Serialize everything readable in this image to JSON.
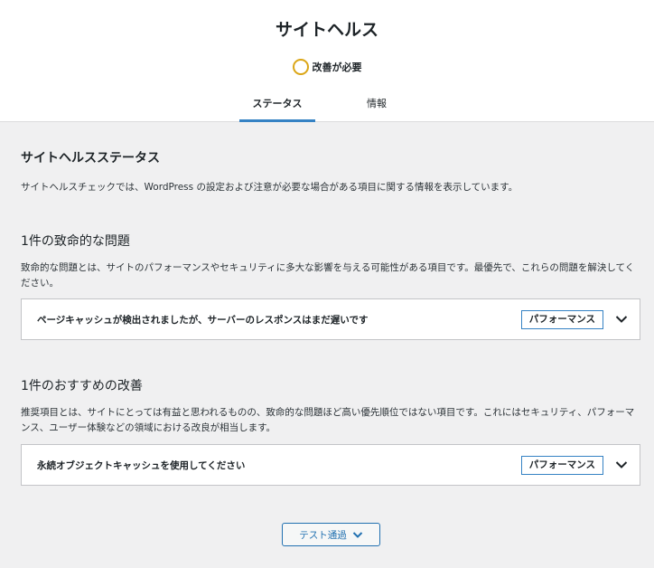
{
  "header": {
    "title": "サイトヘルス",
    "status_label": "改善が必要",
    "status_color": "#dba617",
    "tabs": [
      {
        "label": "ステータス",
        "active": true
      },
      {
        "label": "情報",
        "active": false
      }
    ]
  },
  "main": {
    "section_title": "サイトヘルスステータス",
    "section_desc": "サイトヘルスチェックでは、WordPress の設定および注意が必要な場合がある項目に関する情報を表示しています。",
    "critical": {
      "title": "1件の致命的な問題",
      "desc": "致命的な問題とは、サイトのパフォーマンスやセキュリティに多大な影響を与える可能性がある項目です。最優先で、これらの問題を解決してください。",
      "items": [
        {
          "label": "ページキャッシュが検出されましたが、サーバーのレスポンスはまだ遅いです",
          "badge": "パフォーマンス",
          "icon": "chevron-down-icon"
        }
      ]
    },
    "recommended": {
      "title": "1件のおすすめの改善",
      "desc": "推奨項目とは、サイトにとっては有益と思われるものの、致命的な問題ほど高い優先順位ではない項目です。これにはセキュリティ、パフォーマンス、ユーザー体験などの領域における改良が相当します。",
      "items": [
        {
          "label": "永続オブジェクトキャッシュを使用してください",
          "badge": "パフォーマンス",
          "icon": "chevron-down-icon"
        }
      ]
    },
    "passed_button": "テスト通過"
  },
  "colors": {
    "accent": "#2271b1",
    "tab_underline": "#3582c4",
    "background": "#f0f0f1"
  }
}
